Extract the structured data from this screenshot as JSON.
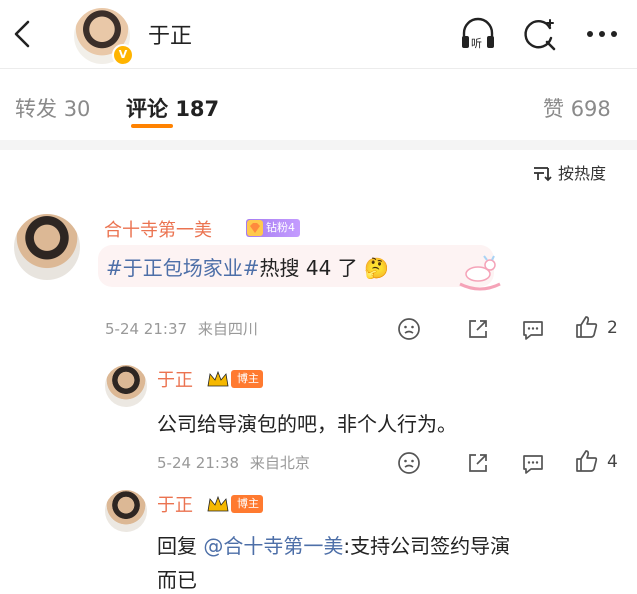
{
  "header": {
    "back_label": "<",
    "title": "于正",
    "verified": "V"
  },
  "tabs": [
    {
      "label": "转发",
      "count": "30"
    },
    {
      "label": "评论",
      "count": "187"
    },
    {
      "label": "赞",
      "count": "698"
    }
  ],
  "sort": {
    "label": "按热度"
  },
  "comment": {
    "user": "合十寺第一美",
    "fan_badge": "钻粉4",
    "topic": "#于正包场家业#",
    "text": "热搜 44 了",
    "emoji": "🤔",
    "time": "5-24 21:37",
    "location": "来自四川",
    "likes": "2"
  },
  "replies": [
    {
      "user": "于正",
      "badge": "博主",
      "text": "公司给导演包的吧，非个人行为。",
      "time": "5-24 21:38",
      "location": "来自北京",
      "likes": "4"
    },
    {
      "user": "于正",
      "badge": "博主",
      "reply_prefix": "回复",
      "mention": "@合十寺第一美",
      "text_line1": ":支持公司签约导演",
      "text_line2": "而已"
    }
  ],
  "colors": {
    "accent": "#ff8200",
    "username": "#eb7350",
    "link": "#4d6fa8"
  }
}
